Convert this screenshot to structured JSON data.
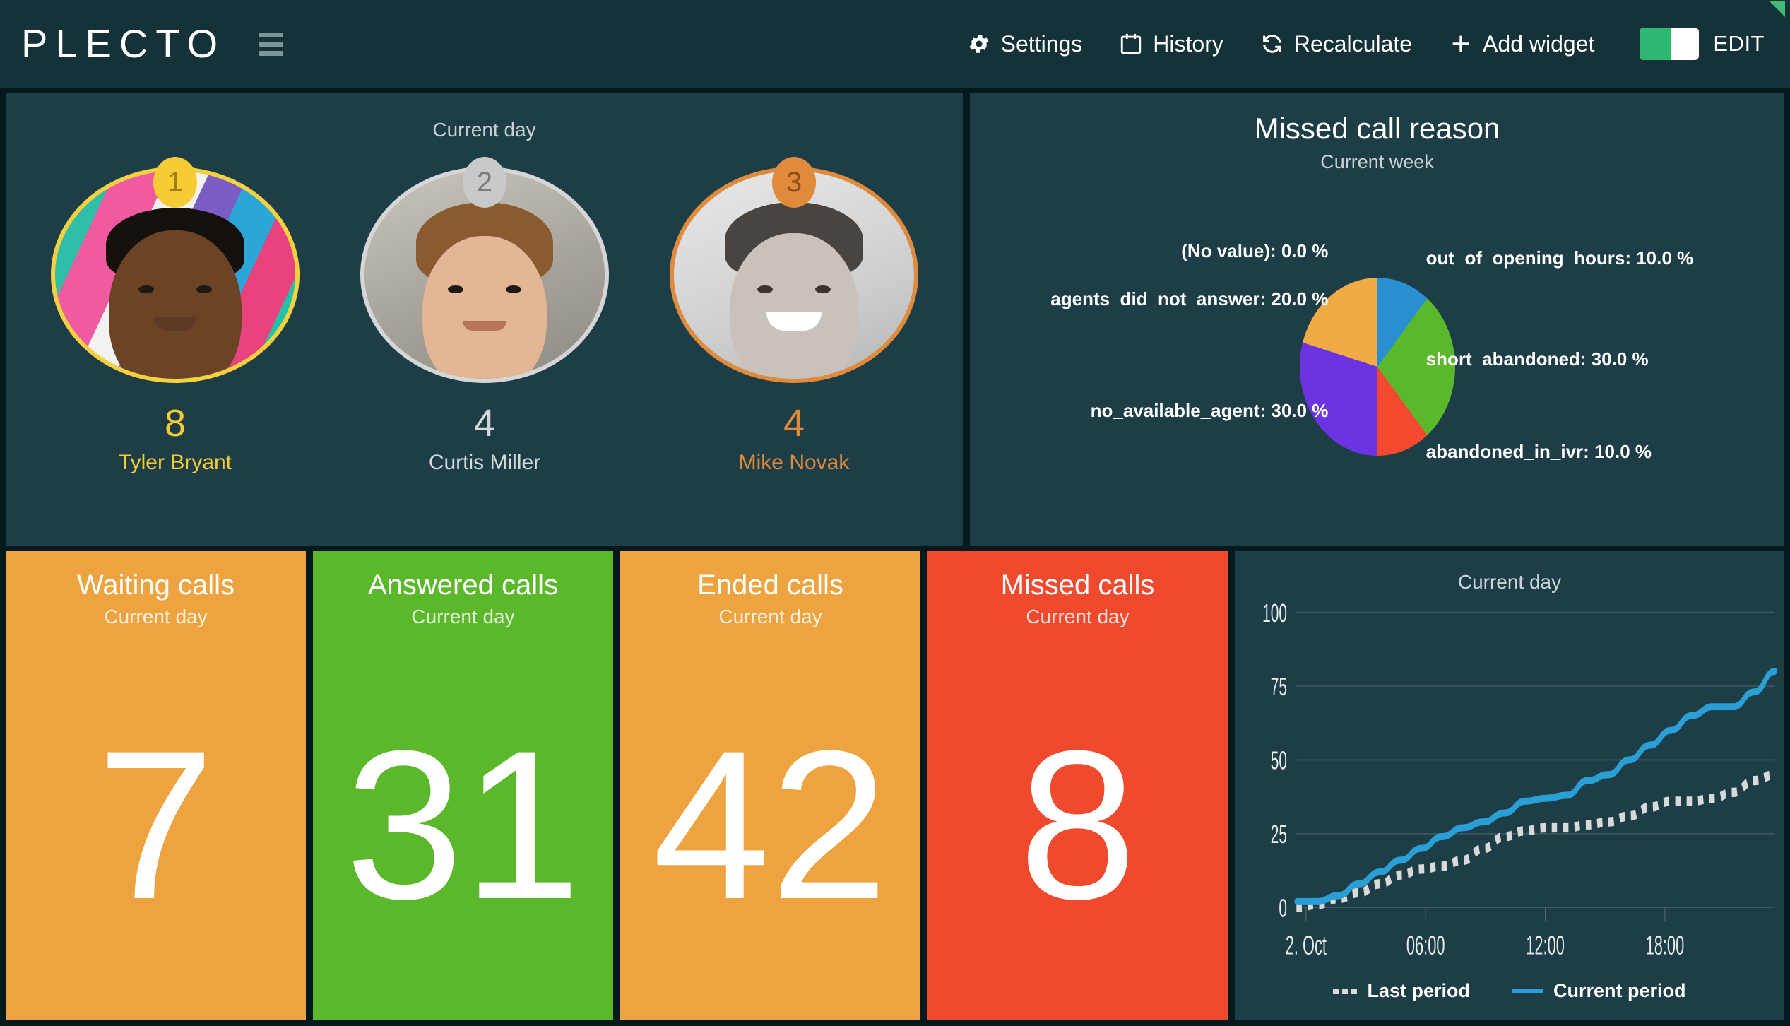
{
  "header": {
    "logo": "PLECTO",
    "menu_icon": "hamburger-icon",
    "actions": [
      {
        "label": "Settings",
        "icon": "gear-icon"
      },
      {
        "label": "History",
        "icon": "calendar-icon"
      },
      {
        "label": "Recalculate",
        "icon": "refresh-icon"
      },
      {
        "label": "Add widget",
        "icon": "plus-icon"
      }
    ],
    "edit_label": "EDIT",
    "toggle_state": "on"
  },
  "leaderboard": {
    "period": "Current day",
    "people": [
      {
        "rank": "1",
        "score": "8",
        "name": "Tyler Bryant",
        "medal": "gold"
      },
      {
        "rank": "2",
        "score": "4",
        "name": "Curtis Miller",
        "medal": "silver"
      },
      {
        "rank": "3",
        "score": "4",
        "name": "Mike Novak",
        "medal": "bronze"
      }
    ]
  },
  "pie_widget": {
    "title": "Missed call reason",
    "period": "Current week",
    "labels": {
      "no_value": "(No value): 0.0 %",
      "agents_did_not_answer": "agents_did_not_answer: 20.0 %",
      "no_available_agent": "no_available_agent: 30.0 %",
      "out_of_opening_hours": "out_of_opening_hours: 10.0 %",
      "short_abandoned": "short_abandoned: 30.0 %",
      "abandoned_in_ivr": "abandoned_in_ivr: 10.0 %"
    }
  },
  "kpis": [
    {
      "title": "Waiting calls",
      "period": "Current day",
      "value": "7",
      "color": "#eda33f"
    },
    {
      "title": "Answered calls",
      "period": "Current day",
      "value": "31",
      "color": "#5cb82b"
    },
    {
      "title": "Ended calls",
      "period": "Current day",
      "value": "42",
      "color": "#eda33f"
    },
    {
      "title": "Missed calls",
      "period": "Current day",
      "value": "8",
      "color": "#f04a2e"
    }
  ],
  "chart_widget": {
    "period": "Current day",
    "legend": [
      {
        "label": "Last period",
        "style": "dotted",
        "color": "#d9d9d9"
      },
      {
        "label": "Current period",
        "style": "solid",
        "color": "#2a9fd6"
      }
    ]
  },
  "chart_data": {
    "type": "line",
    "title": "",
    "subtitle": "Current day",
    "xlabel": "",
    "ylabel": "",
    "ylim": [
      0,
      100
    ],
    "yticks": [
      0,
      25,
      50,
      75,
      100
    ],
    "xticks": [
      "2. Oct",
      "06:00",
      "12:00",
      "18:00"
    ],
    "grid": true,
    "legend_position": "bottom",
    "x": [
      0,
      1,
      2,
      3,
      4,
      5,
      6,
      7,
      8,
      9,
      10,
      11,
      12,
      13,
      14,
      15,
      16,
      17,
      18,
      19,
      20,
      21,
      22,
      23
    ],
    "series": [
      {
        "name": "Current period",
        "style": "solid",
        "color": "#2a9fd6",
        "values": [
          2,
          2,
          4,
          8,
          12,
          16,
          20,
          24,
          27,
          29,
          32,
          36,
          37,
          38,
          43,
          45,
          50,
          55,
          60,
          65,
          68,
          68,
          73,
          80
        ]
      },
      {
        "name": "Last period",
        "style": "dotted",
        "color": "#d9d9d9",
        "values": [
          0,
          1,
          3,
          5,
          8,
          11,
          13,
          14,
          16,
          20,
          24,
          26,
          27,
          27,
          28,
          29,
          31,
          34,
          36,
          36,
          37,
          39,
          43,
          45
        ]
      }
    ],
    "pie": {
      "type": "pie",
      "title": "Missed call reason",
      "subtitle": "Current week",
      "labels": [
        "out_of_opening_hours",
        "short_abandoned",
        "abandoned_in_ivr",
        "no_available_agent",
        "agents_did_not_answer",
        "(No value)"
      ],
      "values": [
        10.0,
        30.0,
        10.0,
        30.0,
        20.0,
        0.0
      ],
      "colors": [
        "#2a8fd0",
        "#5cb82b",
        "#f4492e",
        "#6b34e0",
        "#f0ab45",
        "#f0ab45"
      ],
      "unit": "%"
    }
  }
}
